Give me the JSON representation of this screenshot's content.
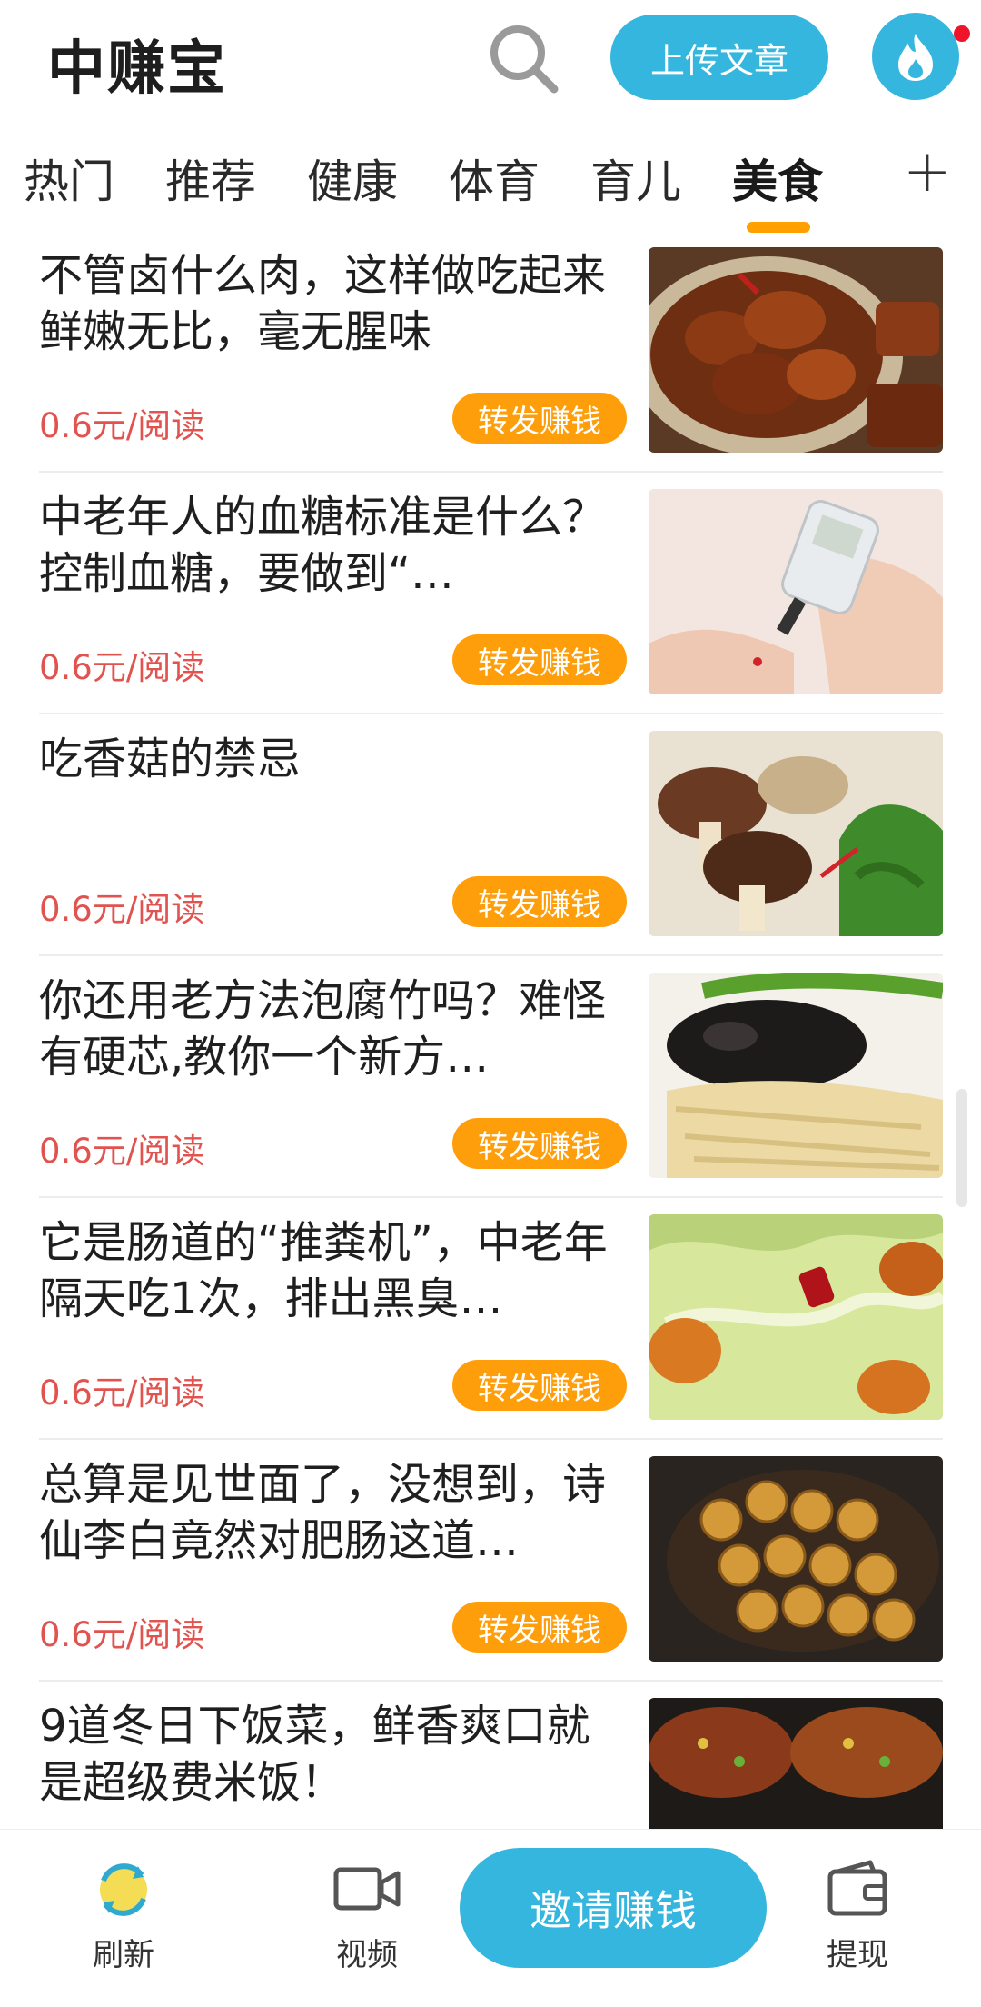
{
  "header": {
    "title": "中赚宝",
    "upload_label": "上传文章",
    "search_icon": "search-icon",
    "fire_icon": "flame-icon",
    "accent": "#35b6de"
  },
  "tabs": {
    "items": [
      {
        "label": "热门"
      },
      {
        "label": "推荐"
      },
      {
        "label": "健康"
      },
      {
        "label": "体育"
      },
      {
        "label": "育儿"
      },
      {
        "label": "美食"
      }
    ],
    "active": "美食",
    "add_label": "+"
  },
  "articles": [
    {
      "title": "不管卤什么肉，这样做吃起来鲜嫩无比，毫无腥味",
      "price": "0.6元/阅读",
      "share_label": "转发赚钱"
    },
    {
      "title": "中老年人的血糖标准是什么？控制血糖，要做到“…",
      "price": "0.6元/阅读",
      "share_label": "转发赚钱"
    },
    {
      "title": "吃香菇的禁忌",
      "price": "0.6元/阅读",
      "share_label": "转发赚钱"
    },
    {
      "title": "你还用老方法泡腐竹吗？难怪有硬芯,教你一个新方…",
      "price": "0.6元/阅读",
      "share_label": "转发赚钱"
    },
    {
      "title": "它是肠道的“推粪机”，中老年隔天吃1次，排出黑臭…",
      "price": "0.6元/阅读",
      "share_label": "转发赚钱"
    },
    {
      "title": "总算是见世面了，没想到，诗仙李白竟然对肥肠这道…",
      "price": "0.6元/阅读",
      "share_label": "转发赚钱"
    },
    {
      "title": "9道冬日下饭菜，鲜香爽口就是超级费米饭！",
      "price": "",
      "share_label": ""
    }
  ],
  "bottom_nav": {
    "refresh_label": "刷新",
    "video_label": "视频",
    "invite_label": "邀请赚钱",
    "withdraw_label": "提现"
  }
}
